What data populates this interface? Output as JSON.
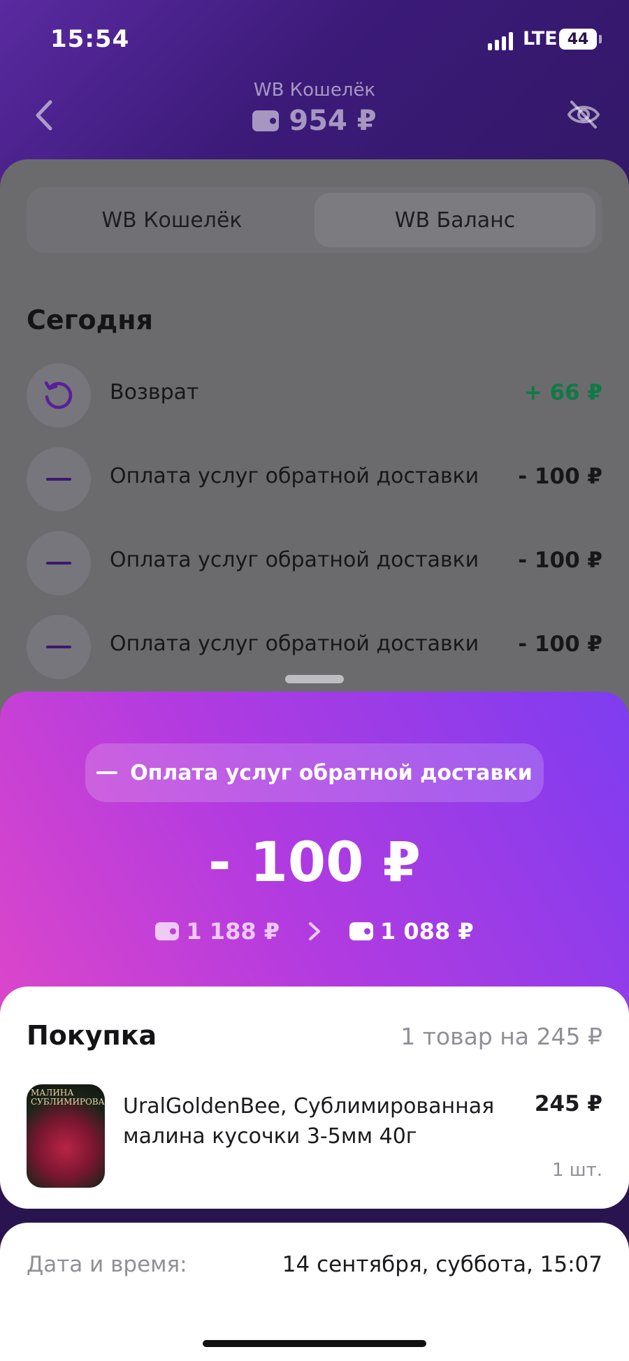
{
  "status_bar": {
    "time": "15:54",
    "network": "LTE",
    "battery": "44"
  },
  "header": {
    "title": "WB Кошелёк",
    "balance": "954 ₽"
  },
  "icons": {
    "back": "chevron-left-icon",
    "hide": "eye-off-icon",
    "wallet": "wallet-icon"
  },
  "tabs": [
    {
      "label": "WB Кошелёк",
      "active": false
    },
    {
      "label": "WB Баланс",
      "active": true
    }
  ],
  "section_title": "Сегодня",
  "transactions": [
    {
      "label": "Возврат",
      "amount": "+ 66 ₽",
      "icon": "refund-icon"
    },
    {
      "label": "Оплата услуг обратной доставки",
      "amount": "- 100 ₽",
      "icon": "minus-icon"
    },
    {
      "label": "Оплата услуг обратной доставки",
      "amount": "- 100 ₽",
      "icon": "minus-icon"
    },
    {
      "label": "Оплата услуг обратной доставки",
      "amount": "- 100 ₽",
      "icon": "minus-icon"
    }
  ],
  "detail": {
    "type_label": "Оплата услуг обратной доставки",
    "amount": "- 100 ₽",
    "balance_before": "1 188 ₽",
    "balance_after": "1 088 ₽"
  },
  "purchase": {
    "title": "Покупка",
    "summary": "1 товар на 245 ₽",
    "item": {
      "name": "UralGoldenBee, Сублимированная малина кусочки 3-5мм 40г",
      "price": "245 ₽",
      "qty": "1 шт.",
      "image_text": "МАЛИНА СУБЛИМИРОВАННАЯ"
    }
  },
  "datetime": {
    "label": "Дата и время:",
    "value": "14 сентября, суббота, 15:07"
  },
  "colors": {
    "positive": "#0f7a45",
    "accent": "#3e1670"
  }
}
